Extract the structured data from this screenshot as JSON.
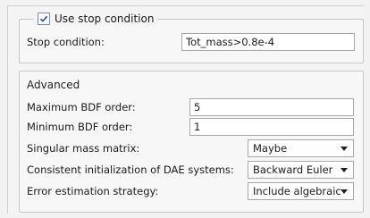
{
  "stop_group": {
    "checkbox_label": "Use stop condition",
    "checked": true,
    "condition_label": "Stop condition:",
    "condition_value": "Tot_mass>0.8e-4"
  },
  "advanced": {
    "title": "Advanced",
    "max_bdf_label": "Maximum BDF order:",
    "max_bdf_value": "5",
    "min_bdf_label": "Minimum BDF order:",
    "min_bdf_value": "1",
    "singular_label": "Singular mass matrix:",
    "singular_value": "Maybe",
    "consistent_label": "Consistent initialization of DAE systems:",
    "consistent_value": "Backward Euler",
    "error_label": "Error estimation strategy:",
    "error_value": "Include algebraic"
  },
  "icons": {
    "checkbox": "checkmark-icon",
    "dropdown": "chevron-down-icon"
  }
}
